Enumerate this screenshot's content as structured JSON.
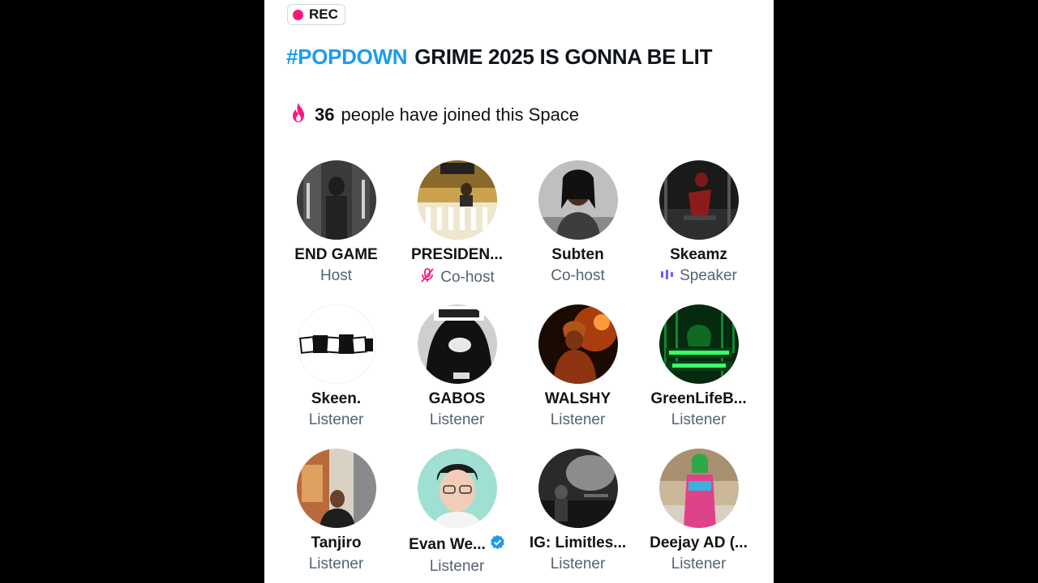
{
  "recording": {
    "label": "REC",
    "color": "#f91880"
  },
  "space": {
    "hashtag": "#POPDOWN",
    "title": "GRIME 2025 IS GONNA BE LIT",
    "joined_count": "36",
    "joined_text": "people have joined this Space"
  },
  "participants": [
    {
      "name": "END GAME",
      "role": "Host",
      "badge": ""
    },
    {
      "name": "PRESIDEN...",
      "role": "Co-host",
      "badge": "muted-mic-icon"
    },
    {
      "name": "Subten",
      "role": "Co-host",
      "badge": ""
    },
    {
      "name": "Skeamz",
      "role": "Speaker",
      "badge": "speaking-bars-icon"
    },
    {
      "name": "Skeen.",
      "role": "Listener",
      "badge": ""
    },
    {
      "name": "GABOS",
      "role": "Listener",
      "badge": ""
    },
    {
      "name": "WALSHY",
      "role": "Listener",
      "badge": ""
    },
    {
      "name": "GreenLifeB...",
      "role": "Listener",
      "badge": ""
    },
    {
      "name": "Tanjiro",
      "role": "Listener",
      "badge": ""
    },
    {
      "name": "Evan We...",
      "role": "Listener",
      "badge": "verified-badge-icon"
    },
    {
      "name": "IG: Limitles...",
      "role": "Listener",
      "badge": ""
    },
    {
      "name": "Deejay AD (...",
      "role": "Listener",
      "badge": ""
    }
  ],
  "colors": {
    "accent": "#1d9bf0",
    "pink": "#f91880",
    "speaker": "#7856ff",
    "text": "#0f1419",
    "muted": "#536471"
  }
}
